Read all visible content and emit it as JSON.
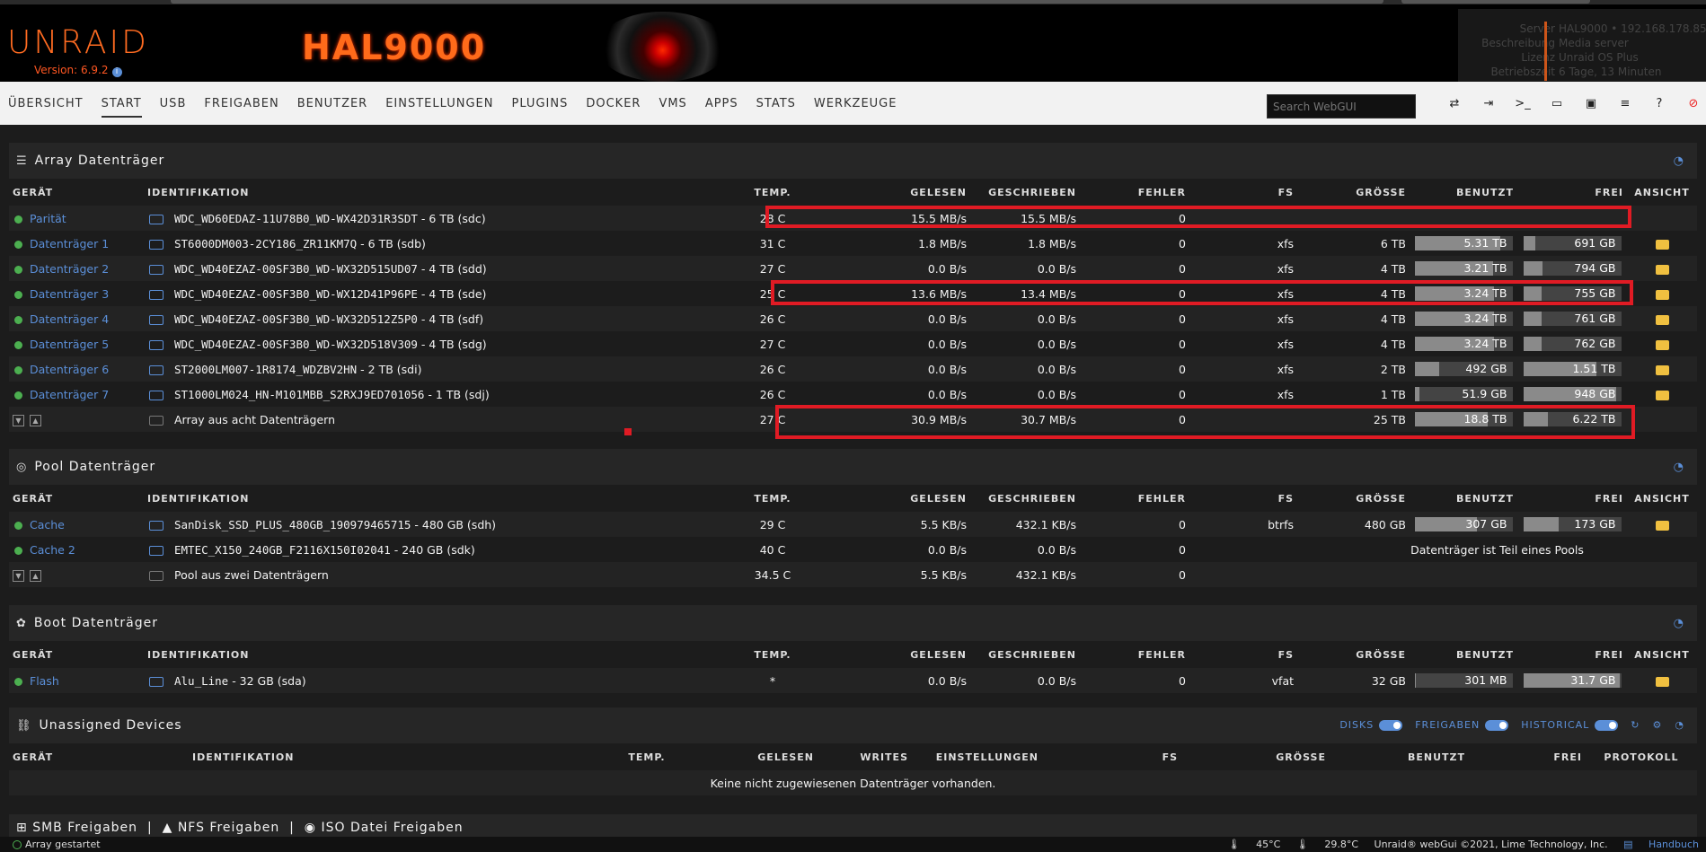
{
  "header": {
    "logo": "UNRAID",
    "version": "Version: 6.9.2",
    "banner_text": "HAL9000",
    "server_labels": [
      "Server",
      "Beschreibung",
      "Lizenz",
      "Betriebszeit"
    ],
    "server_values": [
      "HAL9000 • 192.168.178.85",
      "Media server",
      "Unraid OS Plus",
      "6 Tage, 13 Minuten"
    ]
  },
  "nav": {
    "items": [
      "ÜBERSICHT",
      "START",
      "USB",
      "FREIGABEN",
      "BENUTZER",
      "EINSTELLUNGEN",
      "PLUGINS",
      "DOCKER",
      "VMS",
      "APPS",
      "STATS",
      "WERKZEUGE"
    ],
    "active": "START",
    "search_placeholder": "Search WebGUI"
  },
  "columns": [
    "GERÄT",
    "IDENTIFIKATION",
    "TEMP.",
    "GELESEN",
    "GESCHRIEBEN",
    "FEHLER",
    "FS",
    "GRÖSSE",
    "BENUTZT",
    "FREI",
    "ANSICHT"
  ],
  "array": {
    "title": "Array Datenträger",
    "rows": [
      {
        "device": "Parität",
        "id": "WDC_WD60EDAZ-11U78B0_WD-WX42D31R3SDT",
        "size_label": " - 6 TB (sdc)",
        "temp": "28 C",
        "read": "15.5 MB/s",
        "written": "15.5 MB/s",
        "errors": "0",
        "fs": "",
        "size": "",
        "used": "",
        "used_pct": 0,
        "free": "",
        "free_pct": 0
      },
      {
        "device": "Datenträger 1",
        "id": "ST6000DM003-2CY186_ZR11KM7Q",
        "size_label": " - 6 TB (sdb)",
        "temp": "31 C",
        "read": "1.8 MB/s",
        "written": "1.8 MB/s",
        "errors": "0",
        "fs": "xfs",
        "size": "6 TB",
        "used": "5.31 TB",
        "used_pct": 88,
        "free": "691 GB",
        "free_pct": 12
      },
      {
        "device": "Datenträger 2",
        "id": "WDC_WD40EZAZ-00SF3B0_WD-WX32D515UD07",
        "size_label": " - 4 TB (sdd)",
        "temp": "27 C",
        "read": "0.0 B/s",
        "written": "0.0 B/s",
        "errors": "0",
        "fs": "xfs",
        "size": "4 TB",
        "used": "3.21 TB",
        "used_pct": 80,
        "free": "794 GB",
        "free_pct": 20
      },
      {
        "device": "Datenträger 3",
        "id": "WDC_WD40EZAZ-00SF3B0_WD-WX12D41P96PE",
        "size_label": " - 4 TB (sde)",
        "temp": "25 C",
        "read": "13.6 MB/s",
        "written": "13.4 MB/s",
        "errors": "0",
        "fs": "xfs",
        "size": "4 TB",
        "used": "3.24 TB",
        "used_pct": 81,
        "free": "755 GB",
        "free_pct": 19
      },
      {
        "device": "Datenträger 4",
        "id": "WDC_WD40EZAZ-00SF3B0_WD-WX32D512Z5P0",
        "size_label": " - 4 TB (sdf)",
        "temp": "26 C",
        "read": "0.0 B/s",
        "written": "0.0 B/s",
        "errors": "0",
        "fs": "xfs",
        "size": "4 TB",
        "used": "3.24 TB",
        "used_pct": 81,
        "free": "761 GB",
        "free_pct": 19
      },
      {
        "device": "Datenträger 5",
        "id": "WDC_WD40EZAZ-00SF3B0_WD-WX32D518V309",
        "size_label": " - 4 TB (sdg)",
        "temp": "27 C",
        "read": "0.0 B/s",
        "written": "0.0 B/s",
        "errors": "0",
        "fs": "xfs",
        "size": "4 TB",
        "used": "3.24 TB",
        "used_pct": 81,
        "free": "762 GB",
        "free_pct": 19
      },
      {
        "device": "Datenträger 6",
        "id": "ST2000LM007-1R8174_WDZBV2HN",
        "size_label": " - 2 TB (sdi)",
        "temp": "26 C",
        "read": "0.0 B/s",
        "written": "0.0 B/s",
        "errors": "0",
        "fs": "xfs",
        "size": "2 TB",
        "used": "492 GB",
        "used_pct": 25,
        "free": "1.51 TB",
        "free_pct": 75
      },
      {
        "device": "Datenträger 7",
        "id": "ST1000LM024_HN-M101MBB_S2RXJ9ED701056",
        "size_label": " - 1 TB (sdj)",
        "temp": "26 C",
        "read": "0.0 B/s",
        "written": "0.0 B/s",
        "errors": "0",
        "fs": "xfs",
        "size": "1 TB",
        "used": "51.9 GB",
        "used_pct": 5,
        "free": "948 GB",
        "free_pct": 95
      }
    ],
    "summary": {
      "label": "Array aus acht Datenträgern",
      "temp": "27 C",
      "read": "30.9 MB/s",
      "written": "30.7 MB/s",
      "errors": "0",
      "size": "25 TB",
      "used": "18.8 TB",
      "used_pct": 75,
      "free": "6.22 TB",
      "free_pct": 25
    }
  },
  "pool": {
    "title": "Pool Datenträger",
    "rows": [
      {
        "device": "Cache",
        "id": "SanDisk_SSD_PLUS_480GB_190979465715",
        "size_label": " - 480 GB (sdh)",
        "temp": "29 C",
        "read": "5.5 KB/s",
        "written": "432.1 KB/s",
        "errors": "0",
        "fs": "btrfs",
        "size": "480 GB",
        "used": "307 GB",
        "used_pct": 64,
        "free": "173 GB",
        "free_pct": 36
      },
      {
        "device": "Cache 2",
        "id": "EMTEC_X150_240GB_F2116X150I02041",
        "size_label": " - 240 GB (sdk)",
        "temp": "40 C",
        "read": "0.0 B/s",
        "written": "0.0 B/s",
        "errors": "0",
        "note": "Datenträger ist Teil eines Pools"
      }
    ],
    "summary": {
      "label": "Pool aus zwei Datenträgern",
      "temp": "34.5 C",
      "read": "5.5 KB/s",
      "written": "432.1 KB/s",
      "errors": "0"
    }
  },
  "boot": {
    "title": "Boot Datenträger",
    "rows": [
      {
        "device": "Flash",
        "id": "Alu_Line",
        "size_label": " - 32 GB (sda)",
        "temp": "*",
        "read": "0.0 B/s",
        "written": "0.0 B/s",
        "errors": "0",
        "fs": "vfat",
        "size": "32 GB",
        "used": "301 MB",
        "used_pct": 1,
        "free": "31.7 GB",
        "free_pct": 99
      }
    ]
  },
  "unassigned": {
    "title": "Unassigned Devices",
    "options": [
      "DISKS",
      "FREIGABEN",
      "HISTORICAL"
    ],
    "columns": [
      "GERÄT",
      "IDENTIFIKATION",
      "TEMP.",
      "GELESEN",
      "WRITES",
      "EINSTELLUNGEN",
      "FS",
      "GRÖSSE",
      "BENUTZT",
      "FREI",
      "PROTOKOLL"
    ],
    "empty": "Keine nicht zugewiesenen Datenträger vorhanden."
  },
  "shares_bar": {
    "smb": "SMB Freigaben",
    "nfs": "NFS Freigaben",
    "iso": "ISO Datei Freigaben"
  },
  "footer": {
    "status": "Array gestartet",
    "cpu_temp": "45°C",
    "mb_temp": "29.8°C",
    "copyright": "Unraid® webGui ©2021, Lime Technology, Inc.",
    "manual": "Handbuch"
  }
}
